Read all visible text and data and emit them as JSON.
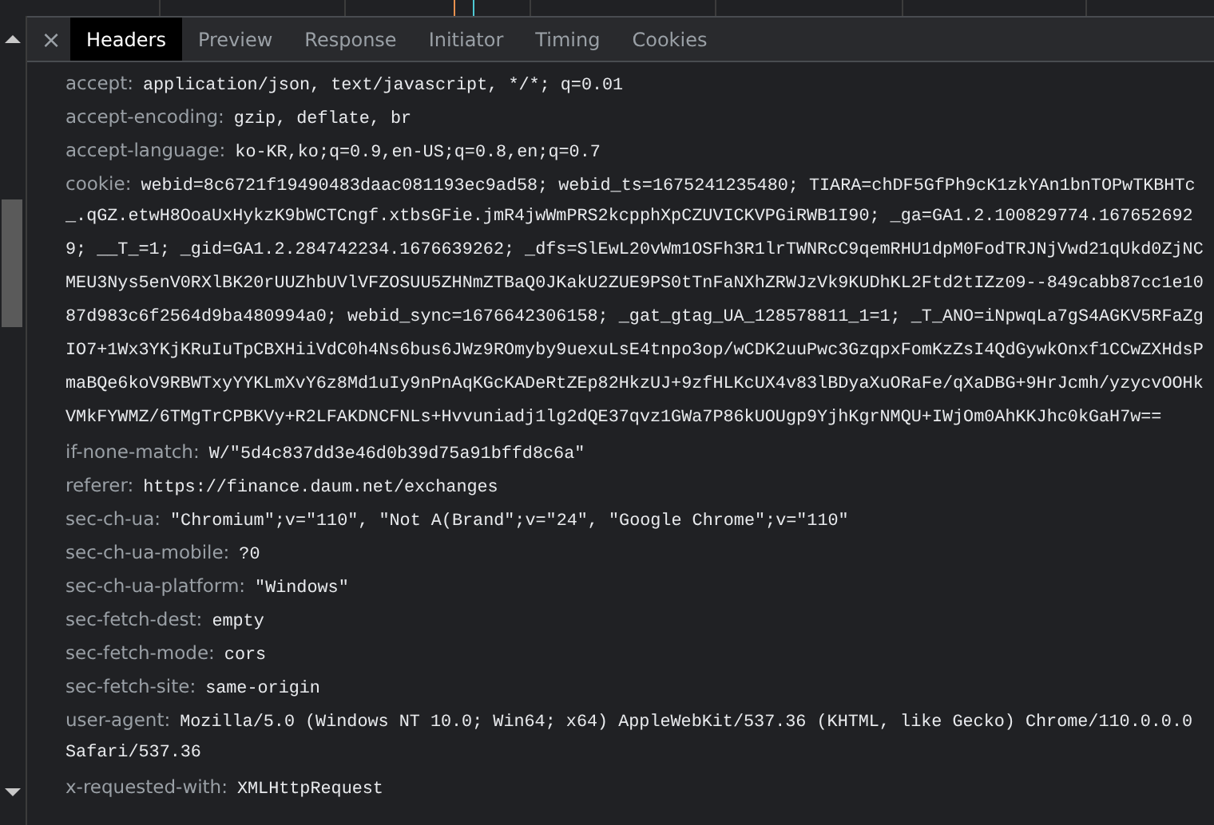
{
  "tabs": [
    {
      "label": "Headers",
      "selected": true
    },
    {
      "label": "Preview",
      "selected": false
    },
    {
      "label": "Response",
      "selected": false
    },
    {
      "label": "Initiator",
      "selected": false
    },
    {
      "label": "Timing",
      "selected": false
    },
    {
      "label": "Cookies",
      "selected": false
    }
  ],
  "close_button": "×",
  "headers": [
    {
      "name": "accept:",
      "lines": [
        "application/json, text/javascript, */*; q=0.01"
      ]
    },
    {
      "name": "accept-encoding:",
      "lines": [
        "gzip, deflate, br"
      ]
    },
    {
      "name": "accept-language:",
      "lines": [
        "ko-KR,ko;q=0.9,en-US;q=0.8,en;q=0.7"
      ]
    },
    {
      "name": "cookie:",
      "lines": [
        "webid=8c6721f19490483daac081193ec9ad58; webid_ts=1675241235480; TIARA=chDF5GfPh9cK1zkYAn1bnTOPwTKBHTc",
        "_.qGZ.etwH8OoaUxHykzK9bWCTCngf.xtbsGFie.jmR4jwWmPRS2kcpphXpCZUVICKVPGiRWB1I90; _ga=GA1.2.100829774.167652692",
        "9; __T_=1; _gid=GA1.2.284742234.1676639262; _dfs=SlEwL20vWm1OSFh3R1lrTWNRcC9qemRHU1dpM0FodTRJNjVwd21qUkd0ZjNC",
        "MEU3Nys5enV0RXlBK20rUUZhbUVlVFZOSUU5ZHNmZTBaQ0JKakU2ZUE9PS0tTnFaNXhZRWJzVk9KUDhKL2Ftd2tIZz09--849cabb87cc1e10",
        "87d983c6f2564d9ba480994a0; webid_sync=1676642306158; _gat_gtag_UA_128578811_1=1; _T_ANO=iNpwqLa7gS4AGKV5RFaZg",
        "IO7+1Wx3YKjKRuIuTpCBXHiiVdC0h4Ns6bus6JWz9ROmyby9uexuLsE4tnpo3op/wCDK2uuPwc3GzqpxFomKzZsI4QdGywkOnxf1CCwZXHdsP",
        "maBQe6koV9RBWTxyYYKLmXvY6z8Md1uIy9nPnAqKGcKADeRtZEp82HkzUJ+9zfHLKcUX4v83lBDyaXuORaFe/qXaDBG+9HrJcmh/yzycvOOHk",
        "VMkFYWMZ/6TMgTrCPBKVy+R2LFAKDNCFNLs+Hvvuniadj1lg2dQE37qvz1GWa7P86kUOUgp9YjhKgrNMQU+IWjOm0AhKKJhc0kGaH7w=="
      ]
    },
    {
      "name": "if-none-match:",
      "lines": [
        "W/\"5d4c837dd3e46d0b39d75a91bffd8c6a\""
      ]
    },
    {
      "name": "referer:",
      "lines": [
        "https://finance.daum.net/exchanges"
      ]
    },
    {
      "name": "sec-ch-ua:",
      "lines": [
        "\"Chromium\";v=\"110\", \"Not A(Brand\";v=\"24\", \"Google Chrome\";v=\"110\""
      ]
    },
    {
      "name": "sec-ch-ua-mobile:",
      "lines": [
        "?0"
      ]
    },
    {
      "name": "sec-ch-ua-platform:",
      "lines": [
        "\"Windows\""
      ]
    },
    {
      "name": "sec-fetch-dest:",
      "lines": [
        "empty"
      ]
    },
    {
      "name": "sec-fetch-mode:",
      "lines": [
        "cors"
      ]
    },
    {
      "name": "sec-fetch-site:",
      "lines": [
        "same-origin"
      ]
    },
    {
      "name": "user-agent:",
      "lines": [
        "Mozilla/5.0 (Windows NT 10.0; Win64; x64) AppleWebKit/537.36 (KHTML, like Gecko) Chrome/110.0.0.0",
        "Safari/537.36"
      ]
    },
    {
      "name": "x-requested-with:",
      "lines": [
        "XMLHttpRequest"
      ]
    }
  ]
}
